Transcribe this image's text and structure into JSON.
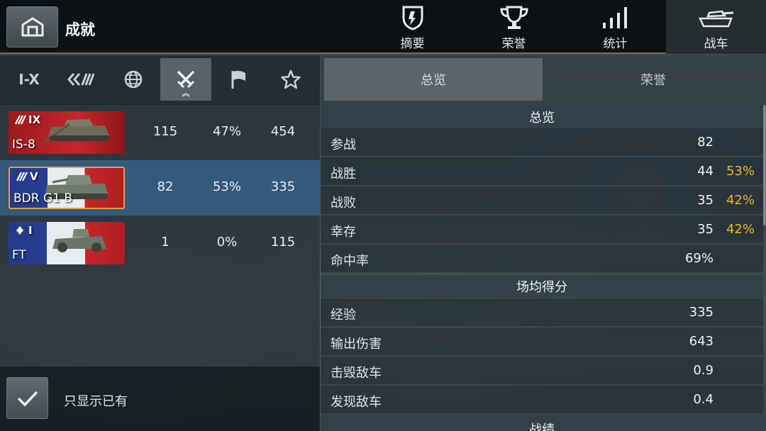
{
  "header": {
    "title": "成就",
    "tabs": [
      {
        "label": "摘要",
        "icon": "shield-icon"
      },
      {
        "label": "荣誉",
        "icon": "trophy-icon"
      },
      {
        "label": "统计",
        "icon": "bar-chart-icon"
      },
      {
        "label": "战车",
        "icon": "tank-icon",
        "active": true
      }
    ]
  },
  "filters": [
    {
      "label": "I-X",
      "icon": "tier-filter"
    },
    {
      "label": "",
      "icon": "vehicle-class-icon"
    },
    {
      "label": "",
      "icon": "globe-icon"
    },
    {
      "label": "",
      "icon": "crossed-swords-icon",
      "active": true
    },
    {
      "label": "",
      "icon": "flag-icon"
    },
    {
      "label": "",
      "icon": "star-icon"
    }
  ],
  "tanks": [
    {
      "name": "IS-8",
      "tier": "IX",
      "nation": "ussr",
      "class_icon": "heavy-tank-icon",
      "battles": "115",
      "winrate": "47%",
      "avg": "454"
    },
    {
      "name": "BDR G1 B",
      "tier": "V",
      "nation": "france",
      "class_icon": "heavy-tank-icon",
      "battles": "82",
      "winrate": "53%",
      "avg": "335",
      "selected": true
    },
    {
      "name": "FT",
      "tier": "I",
      "nation": "france",
      "class_icon": "light-tank-icon",
      "battles": "1",
      "winrate": "0%",
      "avg": "115"
    }
  ],
  "only_owned_label": "只显示已有",
  "sub_tabs": {
    "overview": "总览",
    "honors": "荣誉"
  },
  "sections": [
    {
      "title": "总览",
      "rows": [
        {
          "label": "参战",
          "value": "82",
          "pct": ""
        },
        {
          "label": "战胜",
          "value": "44",
          "pct": "53%"
        },
        {
          "label": "战败",
          "value": "35",
          "pct": "42%"
        },
        {
          "label": "幸存",
          "value": "35",
          "pct": "42%"
        },
        {
          "label": "命中率",
          "value": "69%",
          "pct": ""
        }
      ]
    },
    {
      "title": "场均得分",
      "rows": [
        {
          "label": "经验",
          "value": "335",
          "pct": ""
        },
        {
          "label": "输出伤害",
          "value": "643",
          "pct": ""
        },
        {
          "label": "击毁敌车",
          "value": "0.9",
          "pct": ""
        },
        {
          "label": "发现敌车",
          "value": "0.4",
          "pct": ""
        }
      ]
    },
    {
      "title": "战绩",
      "rows": []
    }
  ],
  "colors": {
    "accent_pct": "#f0b91e",
    "selected_row": "#365c80",
    "selected_border": "#e0a03a"
  }
}
